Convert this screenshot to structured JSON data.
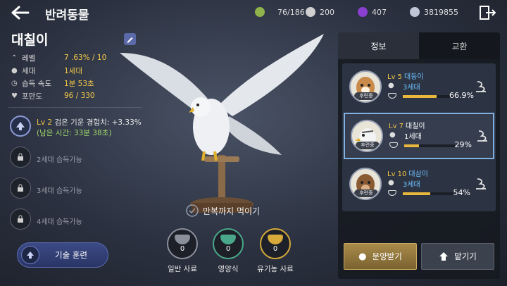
{
  "header": {
    "title": "반려동물",
    "resources": [
      {
        "icon": "pet-slot-icon",
        "value": "76/186",
        "color": "#8fb34a"
      },
      {
        "icon": "silver-coin-icon",
        "value": "200",
        "color": "#cfcfcf"
      },
      {
        "icon": "purple-gem-icon",
        "value": "407",
        "color": "#8a3fd1"
      },
      {
        "icon": "silver-currency-icon",
        "value": "3819855",
        "color": "#bfc6d6"
      }
    ]
  },
  "pet": {
    "name": "대칠이",
    "stats": [
      {
        "icon": "level-icon",
        "label": "레벨",
        "value": "7 .63% / 10"
      },
      {
        "icon": "paw-icon",
        "label": "세대",
        "value": "1세대"
      },
      {
        "icon": "clock-icon",
        "label": "습득 속도",
        "value": "1분 53초"
      },
      {
        "icon": "heart-icon",
        "label": "포만도",
        "value": "96 / 330"
      }
    ],
    "skills": {
      "active": {
        "level": "Lv 2",
        "desc": "검은 기운 경험치: +3.33%",
        "remain": "(남은 시간: 33분 38초)"
      },
      "locked": [
        "2세대 습득가능",
        "3세대 습득가능",
        "4세대 습득가능"
      ]
    },
    "train_label": "기술 훈련"
  },
  "feeding": {
    "feed_all_label": "만복까지 먹이기",
    "items": [
      {
        "name": "일반 사료",
        "count": "0",
        "color": "#8a8f9b"
      },
      {
        "name": "영양식",
        "count": "0",
        "color": "#4aa88a"
      },
      {
        "name": "유기농 사료",
        "count": "0",
        "color": "#d6a93a"
      }
    ]
  },
  "panel": {
    "tabs": [
      "정보",
      "교환"
    ],
    "pets": [
      {
        "level": "Lv 5",
        "name": "대둥이",
        "gen": "3세대",
        "pct": "66.9%",
        "fill": 0.669,
        "tag": "후련중",
        "selected": false
      },
      {
        "level": "Lv 7",
        "name": "대칠이",
        "gen": "1세대",
        "pct": "29%",
        "fill": 0.29,
        "tag": "후련중",
        "selected": true
      },
      {
        "level": "Lv 10",
        "name": "대삼이",
        "gen": "3세대",
        "pct": "54%",
        "fill": 0.54,
        "tag": "후련중",
        "selected": false
      }
    ],
    "adopt_label": "분양받기",
    "deposit_label": "맡기기"
  }
}
